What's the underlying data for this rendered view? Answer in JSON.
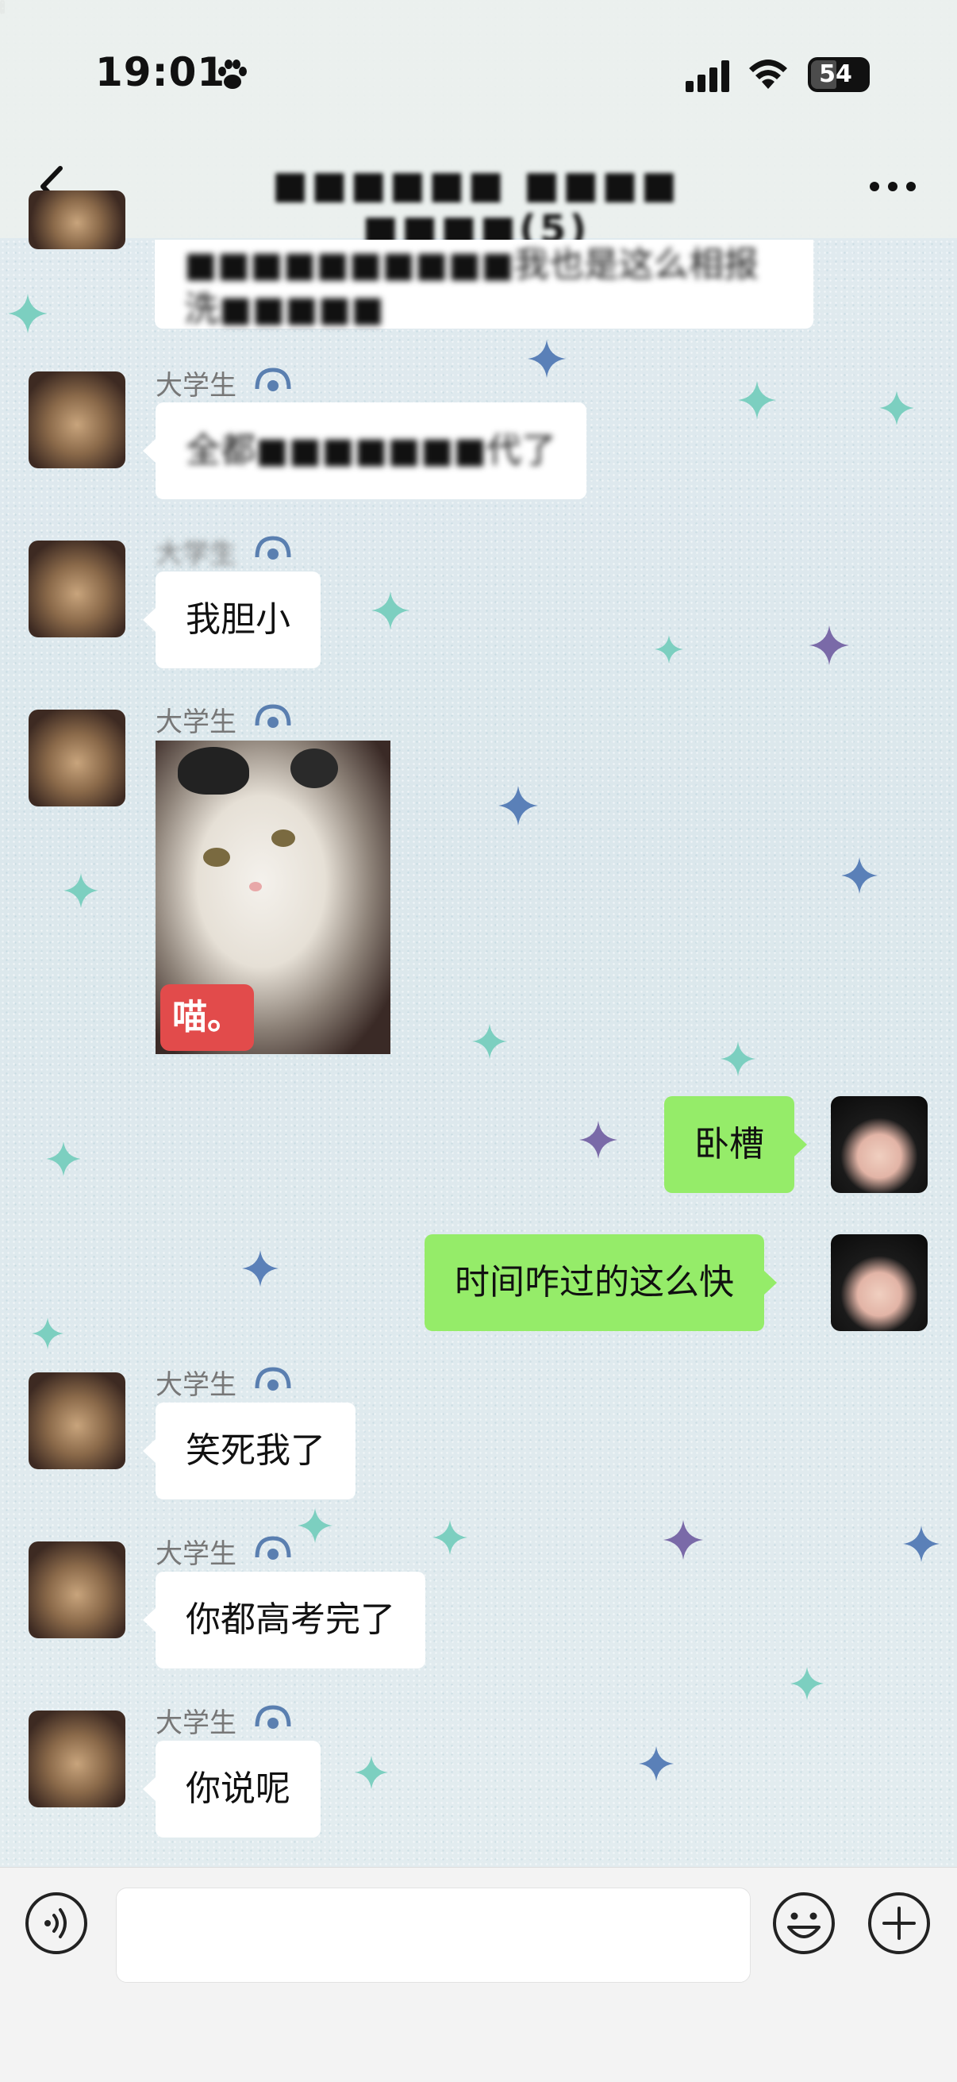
{
  "status_bar": {
    "time": "19:01",
    "battery_level": "54",
    "icons": [
      "paw-icon",
      "signal-icon",
      "wifi-icon",
      "battery-icon"
    ]
  },
  "nav": {
    "back_icon": "chevron-left-icon",
    "title": "■■■■■■ ■■■■ ■■■■(5)",
    "more_icon": "more-dots-icon"
  },
  "messages": [
    {
      "side": "left",
      "text": "■■■■■■■■■■我也是这么相报洗■■■■■",
      "partial_top": true
    },
    {
      "side": "left",
      "sender": "大学生",
      "text": "全都■■■■■■■代了"
    },
    {
      "side": "left",
      "sender": "大学生",
      "text": "我胆小"
    },
    {
      "side": "left",
      "sender": "大学生",
      "type": "image",
      "overlay_text": "喵。"
    },
    {
      "side": "right",
      "text": "卧槽"
    },
    {
      "side": "right",
      "text": "时间咋过的这么快"
    },
    {
      "side": "left",
      "sender": "大学生",
      "text": "笑死我了"
    },
    {
      "side": "left",
      "sender": "大学生",
      "text": "你都高考完了"
    },
    {
      "side": "left",
      "sender": "大学生",
      "text": "你说呢"
    }
  ],
  "input_bar": {
    "voice_icon": "voice-icon",
    "input_value": "",
    "emoji_icon": "emoji-icon",
    "plus_icon": "plus-icon"
  },
  "colors": {
    "own_bubble": "#95ec69",
    "other_bubble": "#ffffff",
    "meow_badge": "#e24b4b"
  }
}
